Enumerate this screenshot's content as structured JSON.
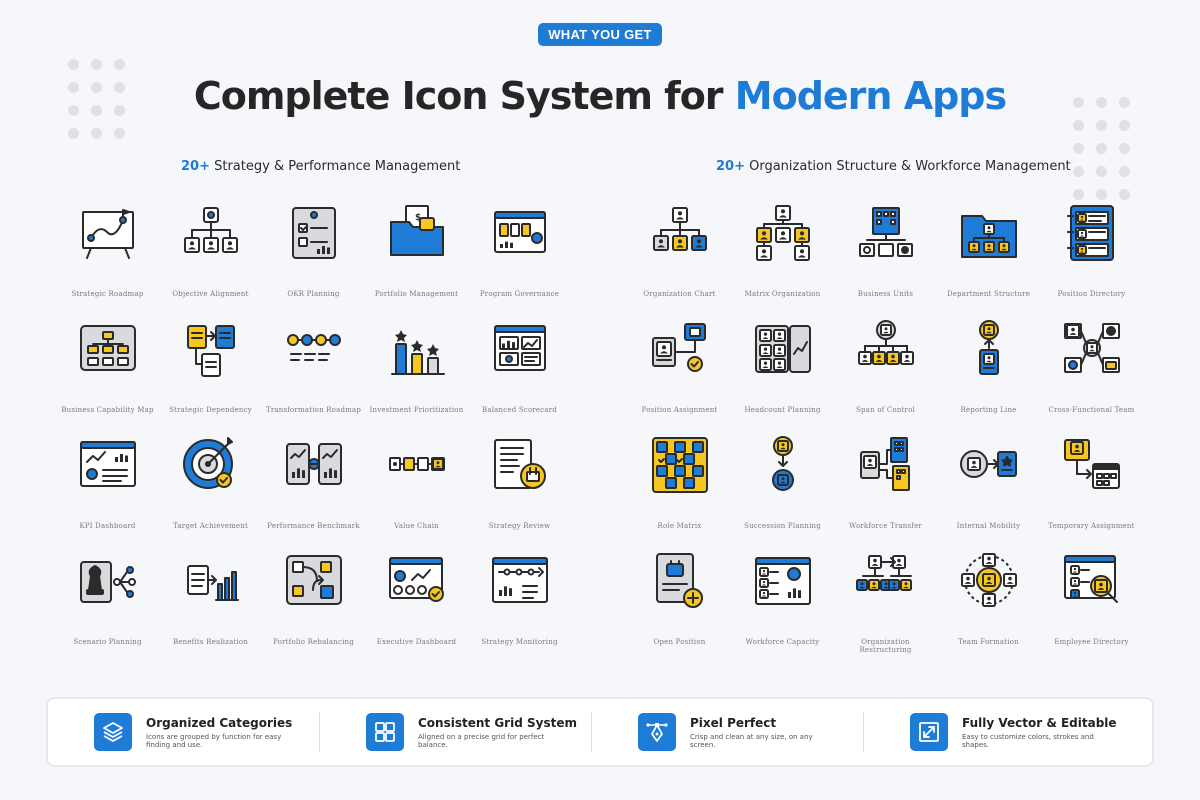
{
  "badge": "WHAT YOU GET",
  "title": {
    "main": "Complete Icon System for ",
    "accent": "Modern Apps"
  },
  "left": {
    "count": "20+",
    "heading": " Strategy & Performance Management",
    "items": [
      {
        "label": "Strategic Roadmap",
        "icon": "roadmap-board"
      },
      {
        "label": "Objective Alignment",
        "icon": "target-hierarchy"
      },
      {
        "label": "OKR Planning",
        "icon": "okr-checklist"
      },
      {
        "label": "Portfolio Management",
        "icon": "portfolio-folder"
      },
      {
        "label": "Program Governance",
        "icon": "program-dashboard"
      },
      {
        "label": "Business Capability Map",
        "icon": "capability-map"
      },
      {
        "label": "Strategic Dependency",
        "icon": "dependency-docs"
      },
      {
        "label": "Transformation Roadmap",
        "icon": "transformation-path"
      },
      {
        "label": "Investment Prioritization",
        "icon": "investment-bars"
      },
      {
        "label": "Balanced Scorecard",
        "icon": "scorecard"
      },
      {
        "label": "KPI Dashboard",
        "icon": "kpi-dashboard"
      },
      {
        "label": "Target Achievement",
        "icon": "target-check"
      },
      {
        "label": "Performance Benchmark",
        "icon": "benchmark-compare"
      },
      {
        "label": "Value Chain",
        "icon": "value-chain"
      },
      {
        "label": "Strategy Review",
        "icon": "strategy-review"
      },
      {
        "label": "Scenario Planning",
        "icon": "scenario-chess"
      },
      {
        "label": "Benefits Realization",
        "icon": "benefits-chart"
      },
      {
        "label": "Portfolio Rebalancing",
        "icon": "portfolio-rebalance"
      },
      {
        "label": "Executive Dashboard",
        "icon": "executive-dashboard"
      },
      {
        "label": "Strategy Monitoring",
        "icon": "strategy-monitor"
      }
    ]
  },
  "right": {
    "count": "20+",
    "heading": " Organization Structure & Workforce Management",
    "items": [
      {
        "label": "Organization Chart",
        "icon": "org-chart"
      },
      {
        "label": "Matrix Organization",
        "icon": "matrix-org"
      },
      {
        "label": "Business Units",
        "icon": "business-units"
      },
      {
        "label": "Department Structure",
        "icon": "department-folder"
      },
      {
        "label": "Position Directory",
        "icon": "position-directory"
      },
      {
        "label": "Position Assignment",
        "icon": "position-assignment"
      },
      {
        "label": "Headcount Planning",
        "icon": "headcount-planning"
      },
      {
        "label": "Span of Control",
        "icon": "span-of-control"
      },
      {
        "label": "Reporting Line",
        "icon": "reporting-line"
      },
      {
        "label": "Cross-Functional Team",
        "icon": "cross-functional-team"
      },
      {
        "label": "Role Matrix",
        "icon": "role-matrix"
      },
      {
        "label": "Succession Planning",
        "icon": "succession-planning"
      },
      {
        "label": "Workforce Transfer",
        "icon": "workforce-transfer"
      },
      {
        "label": "Internal Mobility",
        "icon": "internal-mobility"
      },
      {
        "label": "Temporary Assignment",
        "icon": "temporary-assignment"
      },
      {
        "label": "Open Position",
        "icon": "open-position"
      },
      {
        "label": "Workforce Capacity",
        "icon": "workforce-capacity"
      },
      {
        "label": "Organization Restructuring",
        "icon": "org-restructuring"
      },
      {
        "label": "Team Formation",
        "icon": "team-formation"
      },
      {
        "label": "Employee Directory",
        "icon": "employee-directory"
      }
    ]
  },
  "features": [
    {
      "title": "Organized Categories",
      "desc": "Icons are grouped by function for easy finding and use.",
      "icon": "layers-icon"
    },
    {
      "title": "Consistent Grid System",
      "desc": "Aligned on a precise grid for perfect balance.",
      "icon": "grid-icon"
    },
    {
      "title": "Pixel Perfect",
      "desc": "Crisp and clean at any size, on any screen.",
      "icon": "pen-tool-icon"
    },
    {
      "title": "Fully Vector & Editable",
      "desc": "Easy to customize colors, strokes and shapes.",
      "icon": "resize-icon"
    }
  ],
  "colors": {
    "accent": "#1e7bd6",
    "yellow": "#f6c621",
    "outline": "#2b2b2b",
    "gray": "#d9dadd"
  }
}
